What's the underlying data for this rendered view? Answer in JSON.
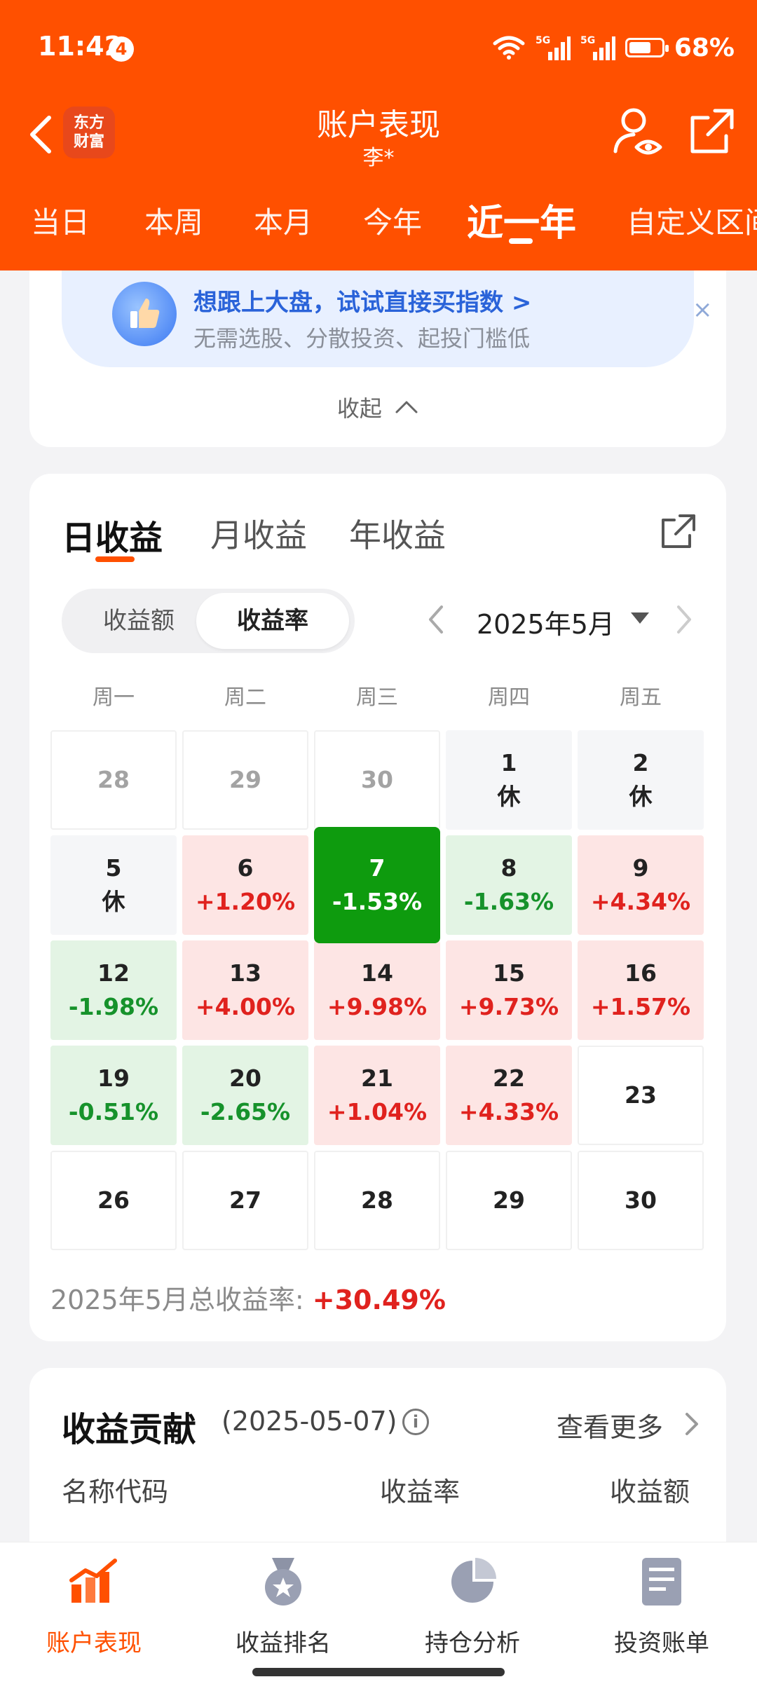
{
  "status_bar": {
    "time": "11:42",
    "notification_count": "4",
    "battery": "68%",
    "signal_labels": [
      "5G",
      "5G"
    ]
  },
  "nav": {
    "title": "账户表现",
    "subtitle": "李*",
    "logo_line1": "东方",
    "logo_line2": "财富"
  },
  "period_tabs": [
    {
      "label": "当日"
    },
    {
      "label": "本周"
    },
    {
      "label": "本月"
    },
    {
      "label": "今年"
    },
    {
      "label": "近一年",
      "active": true
    },
    {
      "label": "自定义区间"
    }
  ],
  "promo": {
    "title": "想跟上大盘，试试直接买指数 >",
    "desc": "无需选股、分散投资、起投门槛低",
    "close": "×",
    "collapse": "收起"
  },
  "calendar": {
    "subtabs": [
      {
        "label": "日收益",
        "active": true
      },
      {
        "label": "月收益"
      },
      {
        "label": "年收益"
      }
    ],
    "toggle": {
      "amount": "收益额",
      "rate": "收益率",
      "selected": "rate"
    },
    "month": "2025年5月",
    "weekdays": [
      "周一",
      "周二",
      "周三",
      "周四",
      "周五"
    ],
    "rows": [
      [
        {
          "day": "28",
          "type": "other"
        },
        {
          "day": "29",
          "type": "other"
        },
        {
          "day": "30",
          "type": "other"
        },
        {
          "day": "1",
          "pct": "休",
          "type": "holiday"
        },
        {
          "day": "2",
          "pct": "休",
          "type": "holiday"
        }
      ],
      [
        {
          "day": "5",
          "pct": "休",
          "type": "holiday"
        },
        {
          "day": "6",
          "pct": "+1.20%",
          "type": "up"
        },
        {
          "day": "7",
          "pct": "-1.53%",
          "type": "strong-down"
        },
        {
          "day": "8",
          "pct": "-1.63%",
          "type": "down"
        },
        {
          "day": "9",
          "pct": "+4.34%",
          "type": "up"
        }
      ],
      [
        {
          "day": "12",
          "pct": "-1.98%",
          "type": "down"
        },
        {
          "day": "13",
          "pct": "+4.00%",
          "type": "up"
        },
        {
          "day": "14",
          "pct": "+9.98%",
          "type": "up"
        },
        {
          "day": "15",
          "pct": "+9.73%",
          "type": "up"
        },
        {
          "day": "16",
          "pct": "+1.57%",
          "type": "up"
        }
      ],
      [
        {
          "day": "19",
          "pct": "-0.51%",
          "type": "down"
        },
        {
          "day": "20",
          "pct": "-2.65%",
          "type": "down"
        },
        {
          "day": "21",
          "pct": "+1.04%",
          "type": "up"
        },
        {
          "day": "22",
          "pct": "+4.33%",
          "type": "up"
        },
        {
          "day": "23",
          "type": "plain"
        }
      ],
      [
        {
          "day": "26",
          "type": "plain"
        },
        {
          "day": "27",
          "type": "plain"
        },
        {
          "day": "28",
          "type": "plain"
        },
        {
          "day": "29",
          "type": "plain"
        },
        {
          "day": "30",
          "type": "plain"
        }
      ]
    ],
    "total_label": "2025年5月总收益率: ",
    "total_value": "+30.49%"
  },
  "contribution": {
    "title": "收益贡献",
    "date": "(2025-05-07)",
    "info": "i",
    "see_more": "查看更多",
    "columns": [
      "名称代码",
      "收益率",
      "收益额"
    ]
  },
  "bottom_nav": [
    {
      "label": "账户表现",
      "icon": "chart-trend-icon",
      "active": true
    },
    {
      "label": "收益排名",
      "icon": "medal-icon"
    },
    {
      "label": "持仓分析",
      "icon": "pie-chart-icon"
    },
    {
      "label": "投资账单",
      "icon": "bill-icon"
    }
  ],
  "colors": {
    "brand": "#ff5000",
    "up": "#e0221e",
    "down": "#16922b",
    "strong_down_bg": "#0e9b0e"
  }
}
